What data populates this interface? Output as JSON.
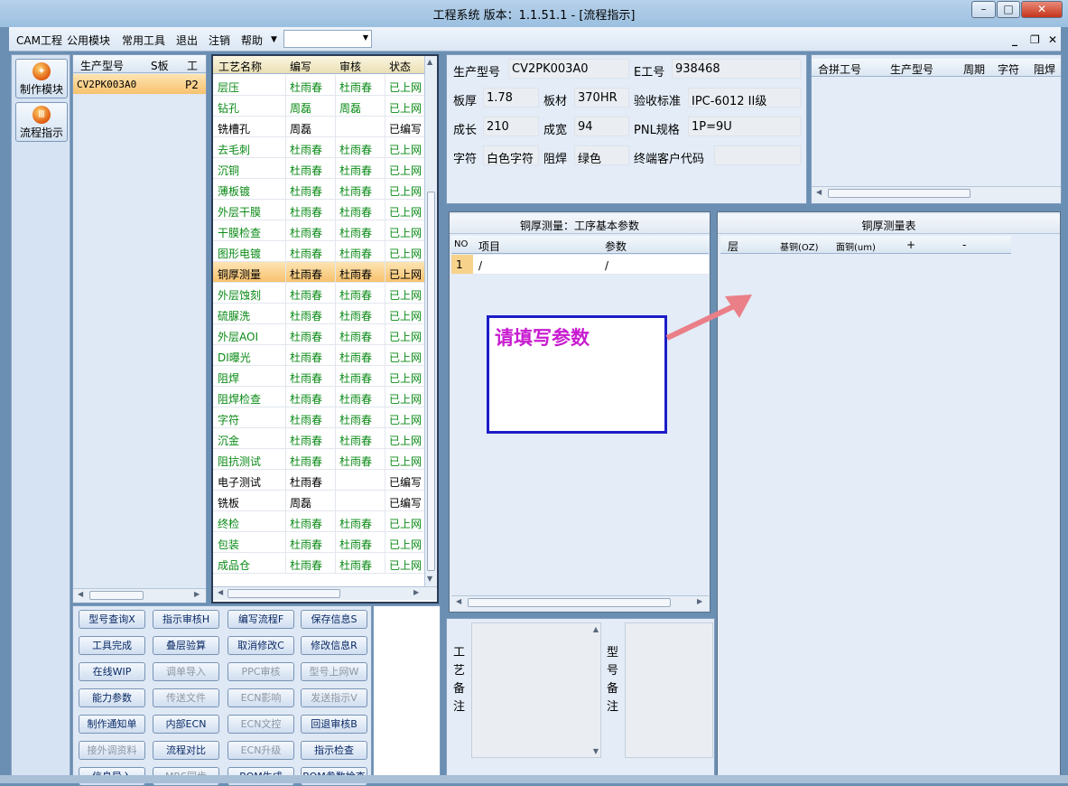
{
  "window": {
    "title": "工程系统   版本：1.1.51.1 - [流程指示]"
  },
  "menu": [
    "CAM工程",
    "公用模块",
    "常用工具",
    "退出",
    "注销",
    "帮助"
  ],
  "nav": [
    {
      "label": "制作模块",
      "icon": "tools-icon"
    },
    {
      "label": "流程指示",
      "icon": "flow-icon"
    }
  ],
  "model_grid": {
    "headers": [
      "生产型号",
      "S板",
      "工"
    ],
    "rows": [
      {
        "model": "CV2PK003A0",
        "s": "P2"
      }
    ]
  },
  "process_grid": {
    "headers": [
      "工艺名称",
      "编写",
      "审核",
      "状态"
    ],
    "rows": [
      {
        "name": "层压",
        "writer": "杜雨春",
        "reviewer": "杜雨春",
        "status": "已上网"
      },
      {
        "name": "钻孔",
        "writer": "周磊",
        "reviewer": "周磊",
        "status": "已上网"
      },
      {
        "name": "铣槽孔",
        "writer": "周磊",
        "reviewer": "",
        "status": "已编写"
      },
      {
        "name": "去毛刺",
        "writer": "杜雨春",
        "reviewer": "杜雨春",
        "status": "已上网"
      },
      {
        "name": "沉铜",
        "writer": "杜雨春",
        "reviewer": "杜雨春",
        "status": "已上网"
      },
      {
        "name": "薄板镀",
        "writer": "杜雨春",
        "reviewer": "杜雨春",
        "status": "已上网"
      },
      {
        "name": "外层干膜",
        "writer": "杜雨春",
        "reviewer": "杜雨春",
        "status": "已上网"
      },
      {
        "name": "干膜检查",
        "writer": "杜雨春",
        "reviewer": "杜雨春",
        "status": "已上网"
      },
      {
        "name": "图形电镀",
        "writer": "杜雨春",
        "reviewer": "杜雨春",
        "status": "已上网"
      },
      {
        "name": "铜厚测量",
        "writer": "杜雨春",
        "reviewer": "杜雨春",
        "status": "已上网"
      },
      {
        "name": "外层蚀刻",
        "writer": "杜雨春",
        "reviewer": "杜雨春",
        "status": "已上网"
      },
      {
        "name": "硫脲洗",
        "writer": "杜雨春",
        "reviewer": "杜雨春",
        "status": "已上网"
      },
      {
        "name": "外层AOI",
        "writer": "杜雨春",
        "reviewer": "杜雨春",
        "status": "已上网"
      },
      {
        "name": "DI曝光",
        "writer": "杜雨春",
        "reviewer": "杜雨春",
        "status": "已上网"
      },
      {
        "name": "阻焊",
        "writer": "杜雨春",
        "reviewer": "杜雨春",
        "status": "已上网"
      },
      {
        "name": "阻焊检查",
        "writer": "杜雨春",
        "reviewer": "杜雨春",
        "status": "已上网"
      },
      {
        "name": "字符",
        "writer": "杜雨春",
        "reviewer": "杜雨春",
        "status": "已上网"
      },
      {
        "name": "沉金",
        "writer": "杜雨春",
        "reviewer": "杜雨春",
        "status": "已上网"
      },
      {
        "name": "阻抗测试",
        "writer": "杜雨春",
        "reviewer": "杜雨春",
        "status": "已上网"
      },
      {
        "name": "电子测试",
        "writer": "杜雨春",
        "reviewer": "",
        "status": "已编写"
      },
      {
        "name": "铣板",
        "writer": "周磊",
        "reviewer": "",
        "status": "已编写"
      },
      {
        "name": "终检",
        "writer": "杜雨春",
        "reviewer": "杜雨春",
        "status": "已上网"
      },
      {
        "name": "包装",
        "writer": "杜雨春",
        "reviewer": "杜雨春",
        "status": "已上网"
      },
      {
        "name": "成品仓",
        "writer": "杜雨春",
        "reviewer": "杜雨春",
        "status": "已上网"
      }
    ]
  },
  "info": {
    "model_label": "生产型号",
    "model": "CV2PK003A0",
    "e_label": "E工号",
    "e_no": "938468",
    "thick_label": "板厚",
    "thick": "1.78",
    "mat_label": "板材",
    "mat": "370HR",
    "std_label": "验收标准",
    "std": "IPC-6012 II级",
    "len_label": "成长",
    "len": "210",
    "wid_label": "成宽",
    "wid": "94",
    "pnl_label": "PNL规格",
    "pnl": "1P=9U",
    "char_label": "字符",
    "char": "白色字符",
    "mask_label": "阻焊",
    "mask": "绿色",
    "cust_label": "终端客户代码",
    "cust": ""
  },
  "combine_grid": {
    "headers": [
      "合拼工号",
      "生产型号",
      "周期",
      "字符",
      "阻焊"
    ]
  },
  "param_panel": {
    "title": "铜厚测量：工序基本参数",
    "headers": [
      "NO",
      "项目",
      "参数"
    ],
    "rows": [
      {
        "no": "1",
        "item": "/",
        "param": "/"
      }
    ]
  },
  "measure_panel": {
    "title": "铜厚测量表",
    "headers": [
      "层",
      "基铜(OZ)",
      "面铜(um)",
      "+",
      "-"
    ]
  },
  "callout": {
    "text": "请填写参数"
  },
  "remarks": {
    "process_label": "工艺备注",
    "model_label": "型号备注"
  },
  "buttons": [
    {
      "label": "型号查询X",
      "enabled": true
    },
    {
      "label": "指示审核H",
      "enabled": true
    },
    {
      "label": "编写流程F",
      "enabled": true
    },
    {
      "label": "保存信息S",
      "enabled": true
    },
    {
      "label": "工具完成",
      "enabled": true
    },
    {
      "label": "叠层验算",
      "enabled": true
    },
    {
      "label": "取消修改C",
      "enabled": true
    },
    {
      "label": "修改信息R",
      "enabled": true
    },
    {
      "label": "在线WIP",
      "enabled": true
    },
    {
      "label": "调单导入",
      "enabled": false
    },
    {
      "label": "PPC审核",
      "enabled": false
    },
    {
      "label": "型号上网W",
      "enabled": false
    },
    {
      "label": "能力参数",
      "enabled": true
    },
    {
      "label": "传送文件",
      "enabled": false
    },
    {
      "label": "ECN影响",
      "enabled": false
    },
    {
      "label": "发送指示V",
      "enabled": false
    },
    {
      "label": "制作通知单",
      "enabled": true
    },
    {
      "label": "内部ECN",
      "enabled": true
    },
    {
      "label": "ECN文控",
      "enabled": false
    },
    {
      "label": "回退审核B",
      "enabled": true
    },
    {
      "label": "接外调资料",
      "enabled": false
    },
    {
      "label": "流程对比",
      "enabled": true
    },
    {
      "label": "ECN升级",
      "enabled": false
    },
    {
      "label": "指示检查",
      "enabled": true
    },
    {
      "label": "信息导入",
      "enabled": true
    },
    {
      "label": "MRS同步",
      "enabled": false
    },
    {
      "label": "BOM生成",
      "enabled": true
    },
    {
      "label": "BOM参数检查",
      "enabled": true
    }
  ]
}
